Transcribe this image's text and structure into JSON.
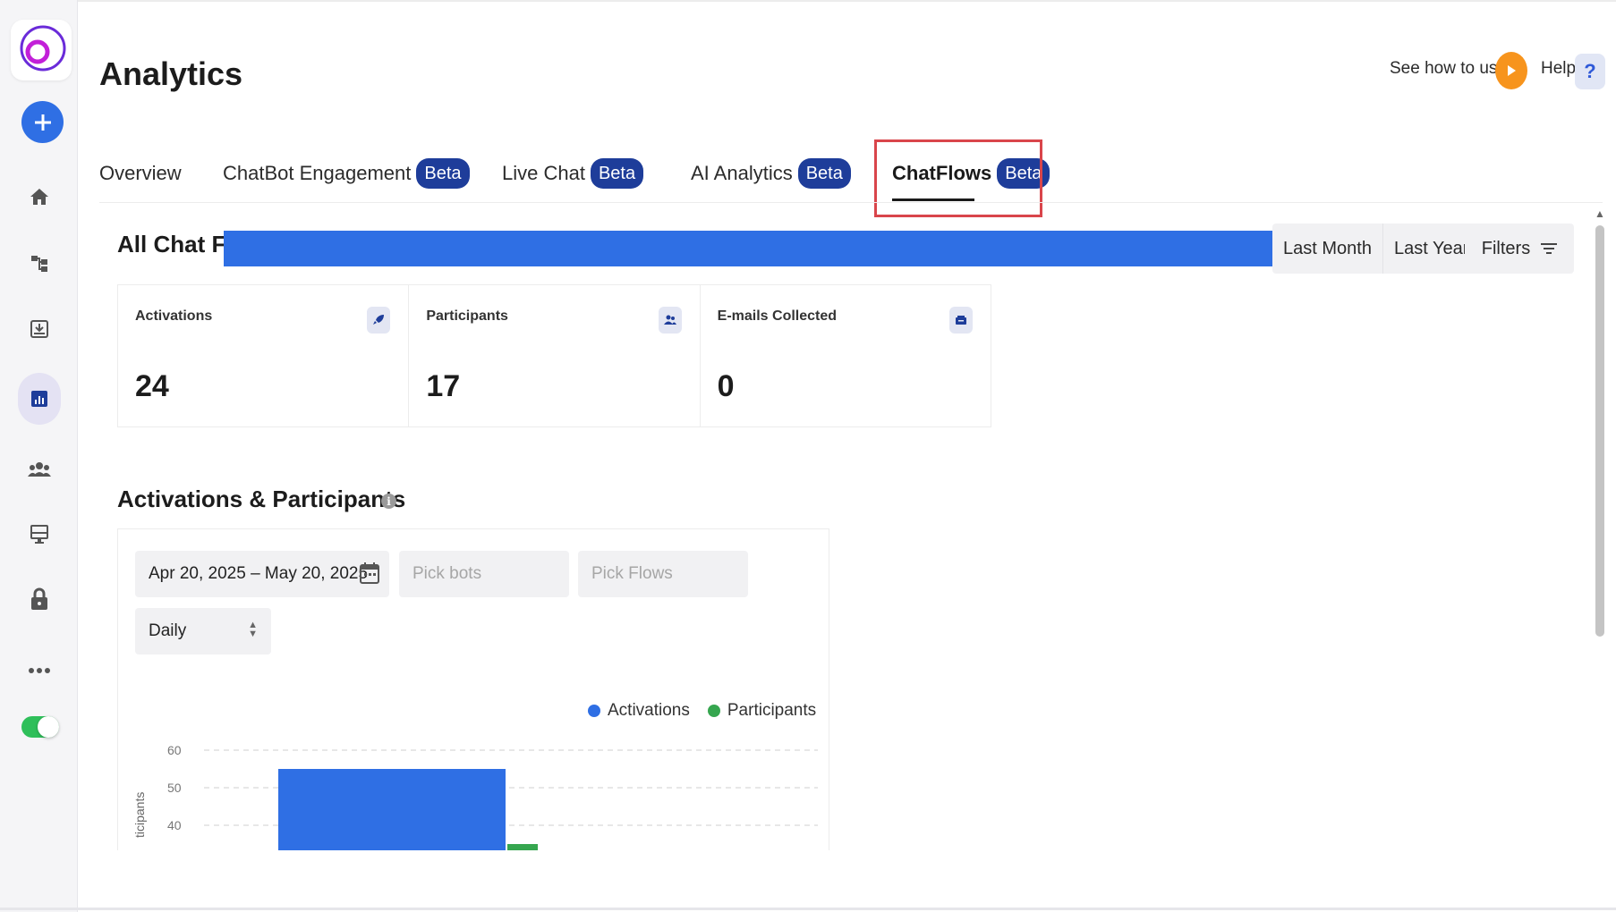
{
  "header": {
    "title": "Analytics",
    "see_how_label": "See how to use",
    "help_label": "Help",
    "help_symbol": "?"
  },
  "tabs": [
    {
      "label": "Overview",
      "badge": ""
    },
    {
      "label": "ChatBot Engagement",
      "badge": "Beta"
    },
    {
      "label": "Live Chat",
      "badge": "Beta"
    },
    {
      "label": "AI Analytics",
      "badge": "Beta"
    },
    {
      "label": "ChatFlows",
      "badge": "Beta",
      "active": true
    }
  ],
  "section": {
    "title": "All Chat Fl",
    "range_buttons": [
      "Last Month",
      "Last Year"
    ],
    "filters_label": "Filters"
  },
  "stats": [
    {
      "label": "Activations",
      "value": "24",
      "icon": "rocket-icon"
    },
    {
      "label": "Participants",
      "value": "17",
      "icon": "users-icon"
    },
    {
      "label": "E-mails Collected",
      "value": "0",
      "icon": "inbox-icon"
    }
  ],
  "activations_participants": {
    "title": "Activations & Participants",
    "info_symbol": "i",
    "date_range": "Apr 20, 2025 – May 20, 2025",
    "pick_bots_placeholder": "Pick bots",
    "pick_flows_placeholder": "Pick Flows",
    "interval": "Daily"
  },
  "chart_data": {
    "type": "bar",
    "ylabel": "ticipants",
    "yticks": [
      60,
      50,
      40
    ],
    "ylim_visible": [
      37,
      63
    ],
    "series": [
      {
        "name": "Activations",
        "color": "#2f6fe4",
        "values": [
          55
        ]
      },
      {
        "name": "Participants",
        "color": "#36a64f",
        "values": [
          null
        ]
      }
    ],
    "grid": true,
    "legend_placement": "top-right"
  },
  "colors": {
    "accent_blue": "#2f6fe4",
    "badge_navy": "#1e3d9a",
    "highlight_red": "#d9454b",
    "toggle_green": "#2fbf5a",
    "play_orange": "#f7941d"
  },
  "sidebar": {
    "items": [
      {
        "name": "home-icon"
      },
      {
        "name": "flows-icon"
      },
      {
        "name": "inbox-download-icon"
      },
      {
        "name": "analytics-icon",
        "active": true
      },
      {
        "name": "team-icon"
      },
      {
        "name": "widget-icon"
      },
      {
        "name": "lock-icon"
      },
      {
        "name": "more-icon"
      }
    ]
  }
}
